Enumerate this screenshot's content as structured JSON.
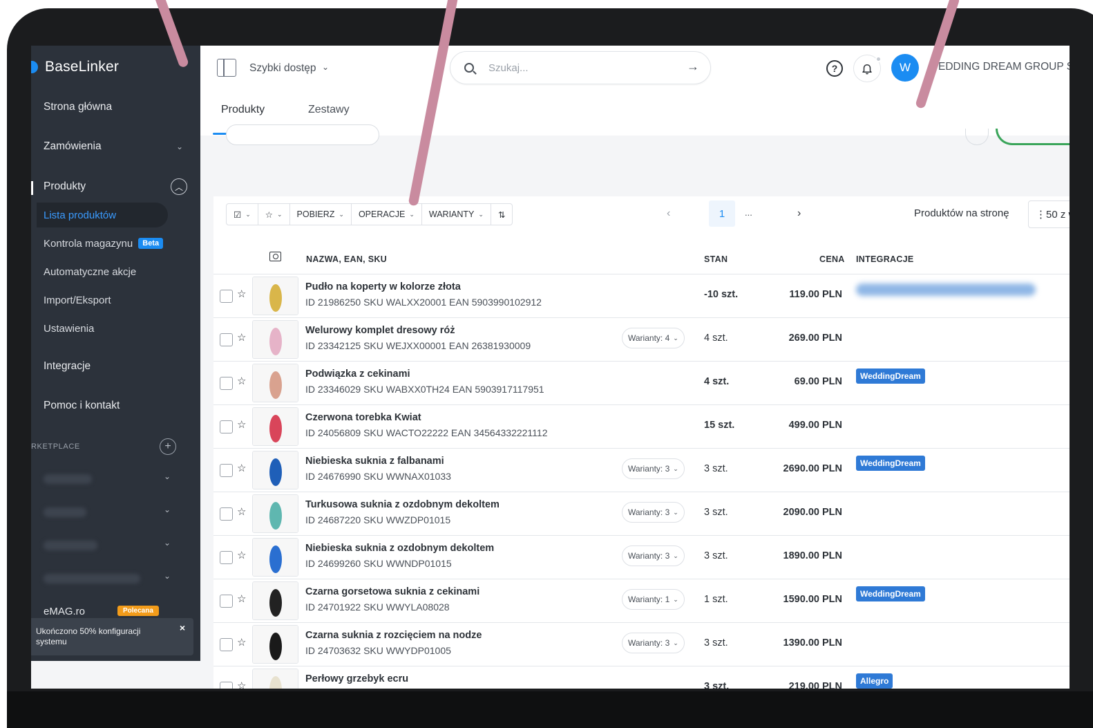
{
  "brand": {
    "name": "BaseLinker"
  },
  "sidebar": {
    "items": [
      {
        "label": "Strona główna",
        "expandable": false
      },
      {
        "label": "Zamówienia",
        "expandable": true
      },
      {
        "label": "Produkty",
        "expandable": true,
        "active": true
      }
    ],
    "sub_items": [
      {
        "label": "Lista produktów",
        "active": true
      },
      {
        "label": "Kontrola magazynu",
        "badge": "Beta"
      },
      {
        "label": "Automatyczne akcje"
      },
      {
        "label": "Import/Eksport"
      },
      {
        "label": "Ustawienia"
      }
    ],
    "bottom_items": [
      {
        "label": "Integracje"
      },
      {
        "label": "Pomoc i kontakt"
      }
    ],
    "section_label": "RKETPLACE",
    "emag": {
      "label": "eMAG.ro",
      "badge": "Polecana"
    },
    "toast": {
      "text": "Ukończono 50% konfiguracji systemu",
      "close": "×"
    }
  },
  "header": {
    "quick_access": "Szybki dostęp",
    "search_placeholder": "Szukaj...",
    "avatar_initial": "W",
    "account_name": "EDDING DREAM GROUP S",
    "tabs": [
      {
        "label": "Produkty",
        "active": true
      },
      {
        "label": "Zestawy",
        "active": false
      }
    ]
  },
  "toolbar": {
    "buttons": [
      "POBIERZ",
      "OPERACJE",
      "WARIANTY"
    ],
    "page_current": "1",
    "page_ellipsis": "...",
    "per_page_label": "Produktów na stronę",
    "per_page_value": "50 z w"
  },
  "table": {
    "columns": {
      "name": "NAZWA, EAN, SKU",
      "stock": "STAN",
      "price": "CENA",
      "integrations": "INTEGRACJE"
    },
    "rows": [
      {
        "name": "Pudło na koperty w kolorze złota",
        "ids": "ID 21986250 SKU WALXX20001 EAN 5903990102912",
        "variants": "",
        "stock": "-10 szt.",
        "stock_bold": true,
        "price": "119.00 PLN",
        "integration": "",
        "integration_blurred": true,
        "thumb_color": "#d9b64a"
      },
      {
        "name": "Welurowy komplet dresowy róż",
        "ids": "ID 23342125 SKU WEJXX00001 EAN 26381930009",
        "variants": "Warianty: 4",
        "stock": "4 szt.",
        "stock_bold": false,
        "price": "269.00 PLN",
        "integration": "",
        "integration_blurred": false,
        "thumb_color": "#e6b3c8"
      },
      {
        "name": "Podwiązka z cekinami",
        "ids": "ID 23346029 SKU WABXX0TH24 EAN 5903917117951",
        "variants": "",
        "stock": "4 szt.",
        "stock_bold": true,
        "price": "69.00 PLN",
        "integration": "WeddingDream",
        "integration_blurred": false,
        "thumb_color": "#d9a28f"
      },
      {
        "name": "Czerwona torebka Kwiat",
        "ids": "ID 24056809 SKU WACTO22222 EAN 34564332221112",
        "variants": "",
        "stock": "15 szt.",
        "stock_bold": true,
        "price": "499.00 PLN",
        "integration": "",
        "integration_blurred": false,
        "thumb_color": "#d9455a"
      },
      {
        "name": "Niebieska suknia z falbanami",
        "ids": "ID 24676990 SKU WWNAX01033",
        "variants": "Warianty: 3",
        "stock": "3 szt.",
        "stock_bold": false,
        "price": "2690.00 PLN",
        "integration": "WeddingDream",
        "integration_blurred": false,
        "thumb_color": "#1f5fb8"
      },
      {
        "name": "Turkusowa suknia z ozdobnym dekoltem",
        "ids": "ID 24687220 SKU WWZDP01015",
        "variants": "Warianty: 3",
        "stock": "3 szt.",
        "stock_bold": false,
        "price": "2090.00 PLN",
        "integration": "",
        "integration_blurred": false,
        "thumb_color": "#5fb7b0"
      },
      {
        "name": "Niebieska suknia z ozdobnym dekoltem",
        "ids": "ID 24699260 SKU WWNDP01015",
        "variants": "Warianty: 3",
        "stock": "3 szt.",
        "stock_bold": false,
        "price": "1890.00 PLN",
        "integration": "",
        "integration_blurred": false,
        "thumb_color": "#2a6fd1"
      },
      {
        "name": "Czarna gorsetowa suknia z cekinami",
        "ids": "ID 24701922 SKU WWYLA08028",
        "variants": "Warianty: 1",
        "stock": "1 szt.",
        "stock_bold": false,
        "price": "1590.00 PLN",
        "integration": "WeddingDream",
        "integration_blurred": false,
        "thumb_color": "#222222"
      },
      {
        "name": "Czarna suknia z rozcięciem na nodze",
        "ids": "ID 24703632 SKU WWYDP01005",
        "variants": "Warianty: 3",
        "stock": "3 szt.",
        "stock_bold": false,
        "price": "1390.00 PLN",
        "integration": "",
        "integration_blurred": false,
        "thumb_color": "#1a1a1a"
      },
      {
        "name": "Perłowy grzebyk ecru",
        "ids": "",
        "variants": "",
        "stock": "3 szt.",
        "stock_bold": true,
        "price": "219.00 PLN",
        "integration": "Allegro",
        "integration_blurred": false,
        "thumb_color": "#e8e2cf"
      }
    ]
  },
  "colors": {
    "accent": "#1b8cf2",
    "sidebar_bg": "#2c323b",
    "badge_weddingdream": "#2f7ad6",
    "badge_allegro": "#2f7ad6",
    "badge_polecana": "#f39c1a",
    "decor_stroke": "#c98b9f"
  }
}
